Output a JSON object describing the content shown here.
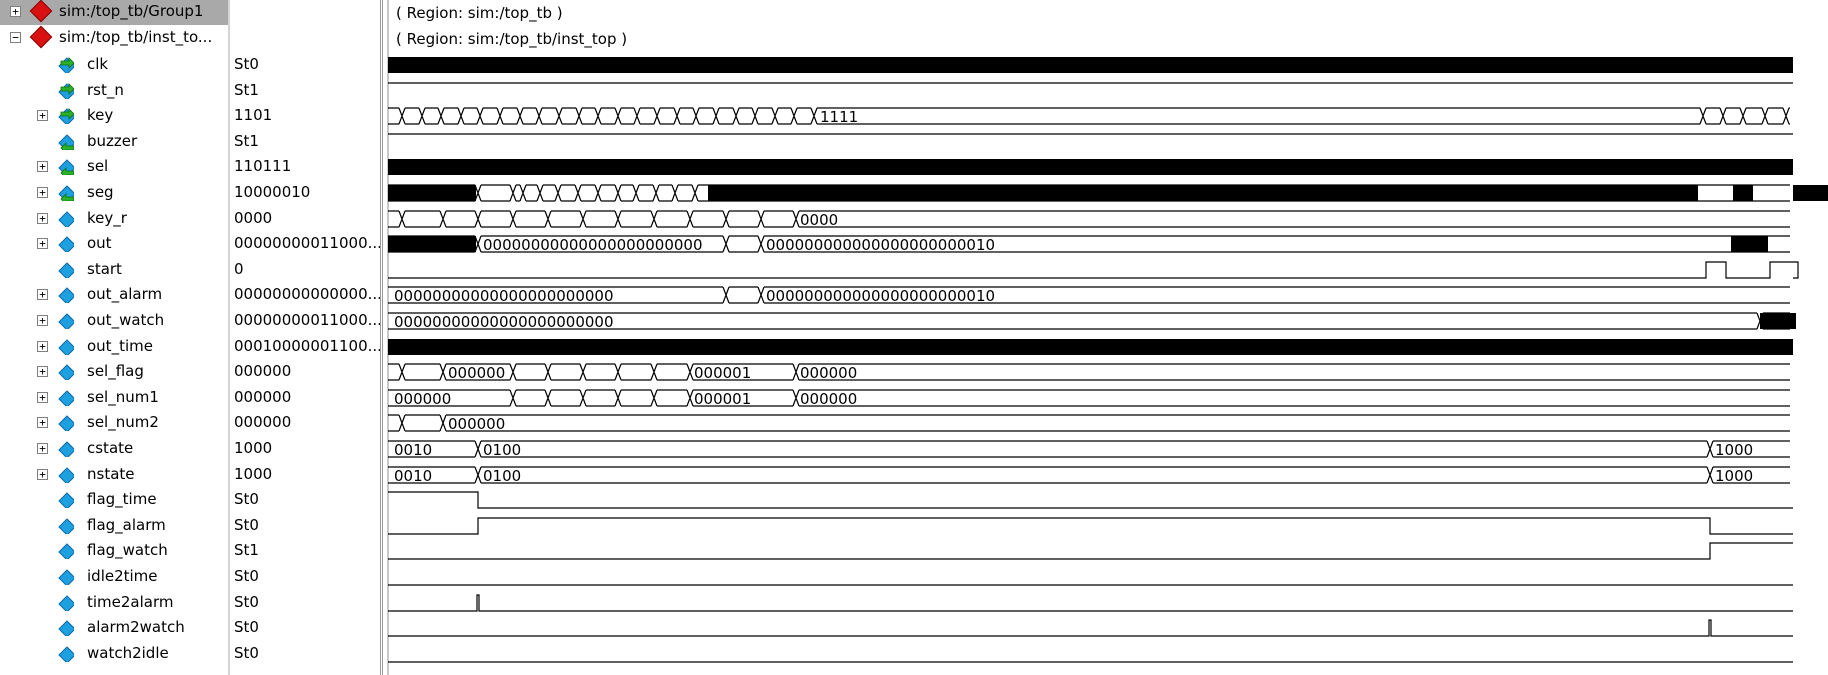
{
  "groups": [
    {
      "name": "sim:/top_tb/Group1",
      "expander": "+",
      "region": "( Region: sim:/top_tb )"
    },
    {
      "name": "sim:/top_tb/inst_to...",
      "expander": "−",
      "region": "( Region: sim:/top_tb/inst_top )"
    }
  ],
  "signals": [
    {
      "name": "clk",
      "value": "St0",
      "bus": false,
      "kind": "in"
    },
    {
      "name": "rst_n",
      "value": "St1",
      "bus": false,
      "kind": "in"
    },
    {
      "name": "key",
      "value": "1101",
      "bus": true,
      "kind": "in"
    },
    {
      "name": "buzzer",
      "value": "St1",
      "bus": false,
      "kind": "out"
    },
    {
      "name": "sel",
      "value": "110111",
      "bus": true,
      "kind": "out"
    },
    {
      "name": "seg",
      "value": "10000010",
      "bus": true,
      "kind": "out"
    },
    {
      "name": "key_r",
      "value": "0000",
      "bus": true,
      "kind": "reg"
    },
    {
      "name": "out",
      "value": "00000000011000...",
      "bus": true,
      "kind": "reg"
    },
    {
      "name": "start",
      "value": "0",
      "bus": false,
      "kind": "reg"
    },
    {
      "name": "out_alarm",
      "value": "00000000000000...",
      "bus": true,
      "kind": "reg"
    },
    {
      "name": "out_watch",
      "value": "00000000011000...",
      "bus": true,
      "kind": "reg"
    },
    {
      "name": "out_time",
      "value": "00010000001100...",
      "bus": true,
      "kind": "reg"
    },
    {
      "name": "sel_flag",
      "value": "000000",
      "bus": true,
      "kind": "reg"
    },
    {
      "name": "sel_num1",
      "value": "000000",
      "bus": true,
      "kind": "reg"
    },
    {
      "name": "sel_num2",
      "value": "000000",
      "bus": true,
      "kind": "reg"
    },
    {
      "name": "cstate",
      "value": "1000",
      "bus": true,
      "kind": "reg"
    },
    {
      "name": "nstate",
      "value": "1000",
      "bus": true,
      "kind": "reg"
    },
    {
      "name": "flag_time",
      "value": "St0",
      "bus": false,
      "kind": "reg"
    },
    {
      "name": "flag_alarm",
      "value": "St0",
      "bus": false,
      "kind": "reg"
    },
    {
      "name": "flag_watch",
      "value": "St1",
      "bus": false,
      "kind": "reg"
    },
    {
      "name": "idle2time",
      "value": "St0",
      "bus": false,
      "kind": "reg"
    },
    {
      "name": "time2alarm",
      "value": "St0",
      "bus": false,
      "kind": "reg"
    },
    {
      "name": "alarm2watch",
      "value": "St0",
      "bus": false,
      "kind": "reg"
    },
    {
      "name": "watch2idle",
      "value": "St0",
      "bus": false,
      "kind": "reg"
    }
  ],
  "waveform_labels": {
    "key": "1111",
    "key_r": "0000",
    "out_a": "00000000000000000000000",
    "out_b": "000000000000000000000010",
    "out_alarm_a": "00000000000000000000000",
    "out_alarm_b": "000000000000000000000010",
    "out_watch_a": "00000000000000000000000",
    "sel_flag_a": "000000",
    "sel_flag_b": "000001",
    "sel_flag_c": "000000",
    "sel_num1_a": "000000",
    "sel_num1_b": "000001",
    "sel_num1_c": "000000",
    "sel_num2_a": "000000",
    "cstate_a": "0010",
    "cstate_b": "0100",
    "cstate_c": "1000",
    "nstate_a": "0010",
    "nstate_b": "0100",
    "nstate_c": "1000"
  },
  "colors": {
    "group_icon": "#d81010",
    "signal_icon": "#1ea0e0",
    "arrow_icon": "#2bb02b",
    "selected_row_bg": "#a9a9a9",
    "wave_color": "#000000"
  }
}
